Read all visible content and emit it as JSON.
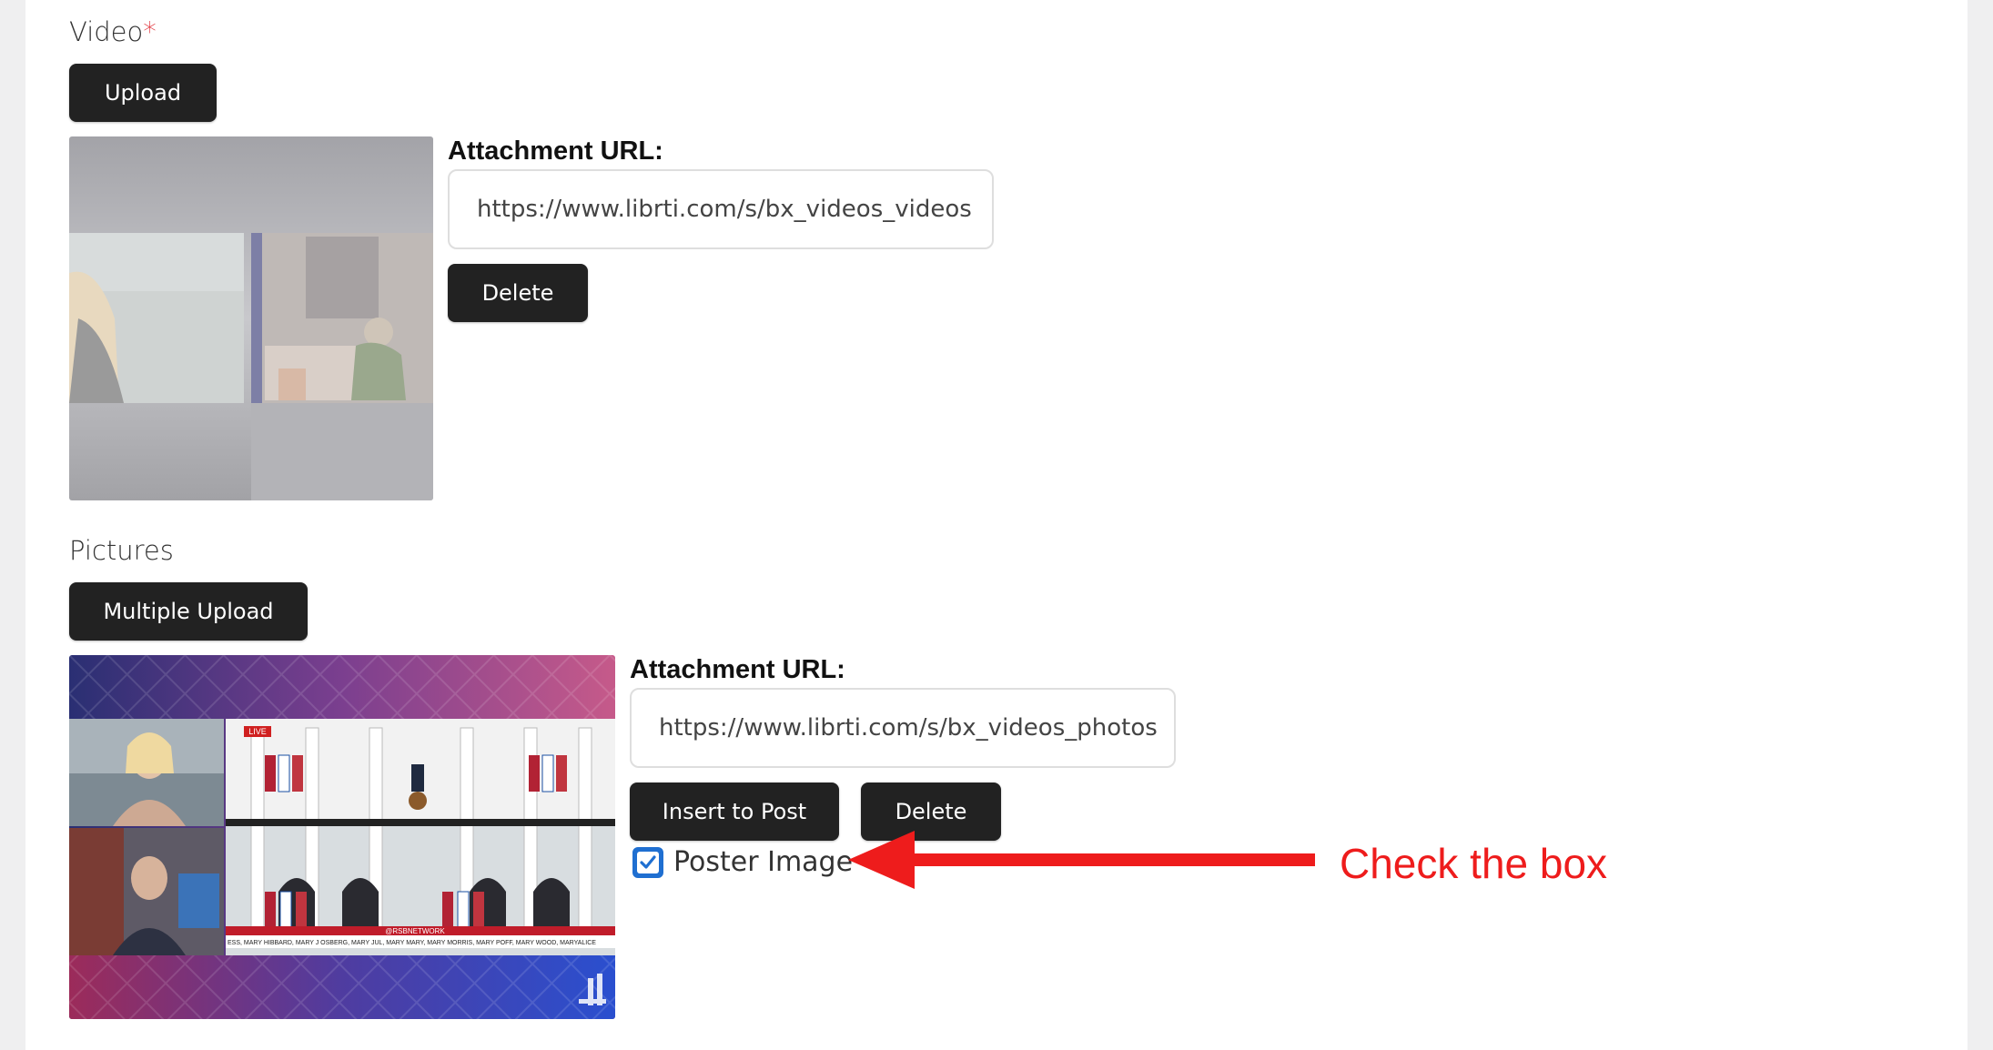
{
  "video": {
    "label": "Video",
    "required_mark": "*",
    "upload_button": "Upload",
    "attachment_label": "Attachment URL:",
    "attachment_url": "https://www.librti.com/s/bx_videos_videos",
    "delete_button": "Delete"
  },
  "pictures": {
    "label": "Pictures",
    "upload_button": "Multiple Upload",
    "attachment_label": "Attachment URL:",
    "attachment_url": "https://www.librti.com/s/bx_videos_photos",
    "insert_button": "Insert to Post",
    "delete_button": "Delete",
    "poster_checkbox_label": "Poster Image",
    "poster_checked": true,
    "thumb_live_badge": "LIVE",
    "thumb_ticker": "@RSBNETWORK",
    "thumb_names": "ESS, MARY HIBBARD, MARY J OSBERG, MARY JUL, MARY MARY, MARY MORRIS, MARY POFF, MARY WOOD, MARYALICE"
  },
  "annotation": {
    "text": "Check the box",
    "color": "#ee1c1c"
  },
  "colors": {
    "button_bg": "#222222",
    "checkbox_accent": "#1f6fd1",
    "required": "#e0323a"
  }
}
